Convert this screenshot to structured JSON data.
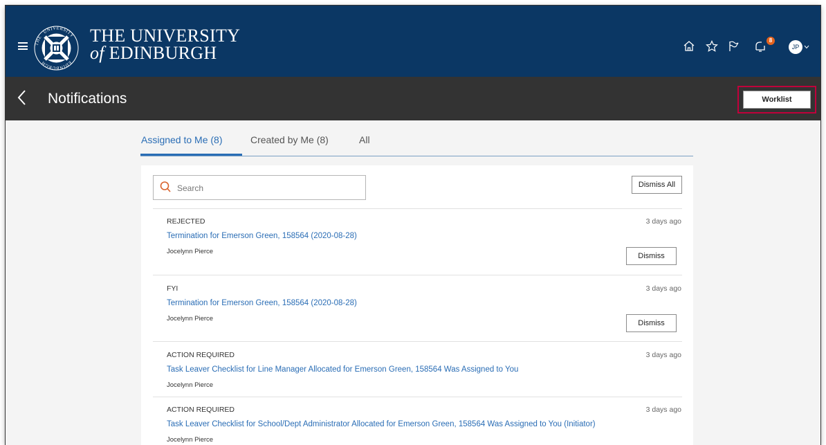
{
  "header": {
    "university_line1": "THE UNIVERSITY",
    "university_line2_italic": "of",
    "university_line2": "EDINBURGH",
    "notification_count": "8",
    "avatar_initials": "JP",
    "crest_ring_text_top": "UNIVERSITY",
    "crest_ring_text_left": "THE",
    "crest_ring_text_bottom": "EDINBURGH",
    "brand_color": "#0b3764",
    "badge_color": "#e4631e"
  },
  "page": {
    "title": "Notifications",
    "worklist_label": "Worklist"
  },
  "tabs": [
    {
      "label": "Assigned to Me (8)",
      "active": true
    },
    {
      "label": "Created by Me (8)",
      "active": false
    },
    {
      "label": "All",
      "active": false
    }
  ],
  "search": {
    "placeholder": "Search",
    "value": ""
  },
  "dismiss_all_label": "Dismiss All",
  "notifications": [
    {
      "status": "REJECTED",
      "time": "3 days ago",
      "title": "Termination for Emerson Green, 158564 (2020-08-28)",
      "person": "Jocelynn Pierce",
      "dismiss_label": "Dismiss"
    },
    {
      "status": "FYI",
      "time": "3 days ago",
      "title": "Termination for Emerson Green, 158564 (2020-08-28)",
      "person": "Jocelynn Pierce",
      "dismiss_label": "Dismiss"
    },
    {
      "status": "ACTION REQUIRED",
      "time": "3 days ago",
      "title": "Task Leaver Checklist for Line Manager Allocated for Emerson Green, 158564 Was Assigned to You",
      "person": "Jocelynn Pierce"
    },
    {
      "status": "ACTION REQUIRED",
      "time": "3 days ago",
      "title": "Task Leaver Checklist for School/Dept Administrator Allocated for Emerson Green, 158564 Was Assigned to You (Initiator)",
      "person": "Jocelynn Pierce"
    }
  ]
}
